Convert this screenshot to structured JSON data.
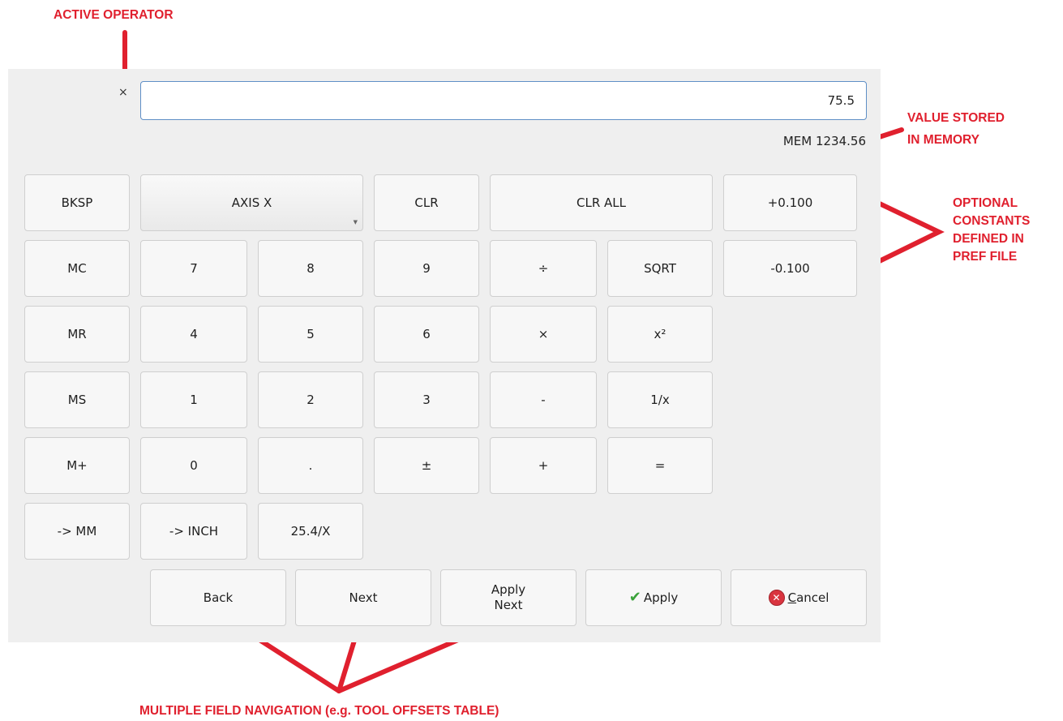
{
  "annotations": {
    "active_operator": "ACTIVE OPERATOR",
    "memory_line1": "VALUE STORED",
    "memory_line2": "IN MEMORY",
    "constants_line1": "OPTIONAL",
    "constants_line2": "CONSTANTS",
    "constants_line3": "DEFINED IN",
    "constants_line4": "PREF FILE",
    "navigation": "MULTIPLE FIELD NAVIGATION (e.g. TOOL OFFSETS TABLE)"
  },
  "calculator": {
    "operator_indicator": "×",
    "display_value": "75.5",
    "memory_label": "MEM 1234.56",
    "axis_select": "AXIS X",
    "keys": {
      "bksp": "BKSP",
      "clr": "CLR",
      "clr_all": "CLR ALL",
      "const_plus": "+0.100",
      "const_minus": "-0.100",
      "mc": "MC",
      "mr": "MR",
      "ms": "MS",
      "mplus": "M+",
      "d7": "7",
      "d8": "8",
      "d9": "9",
      "d4": "4",
      "d5": "5",
      "d6": "6",
      "d1": "1",
      "d2": "2",
      "d3": "3",
      "d0": "0",
      "dot": ".",
      "plusminus": "±",
      "divide": "÷",
      "multiply": "×",
      "minus": "-",
      "plus": "+",
      "sqrt": "SQRT",
      "square": "x²",
      "reciprocal": "1/x",
      "equals": "=",
      "to_mm": "-> MM",
      "to_inch": "-> INCH",
      "inch_factor": "25.4/X"
    },
    "nav": {
      "back": "Back",
      "next": "Next",
      "apply_next_line1": "Apply",
      "apply_next_line2": "Next",
      "apply": "Apply",
      "cancel_mnemonic": "C",
      "cancel_rest": "ancel"
    }
  },
  "colors": {
    "annotation": "#e0202e",
    "display_border": "#5f8fc6"
  }
}
